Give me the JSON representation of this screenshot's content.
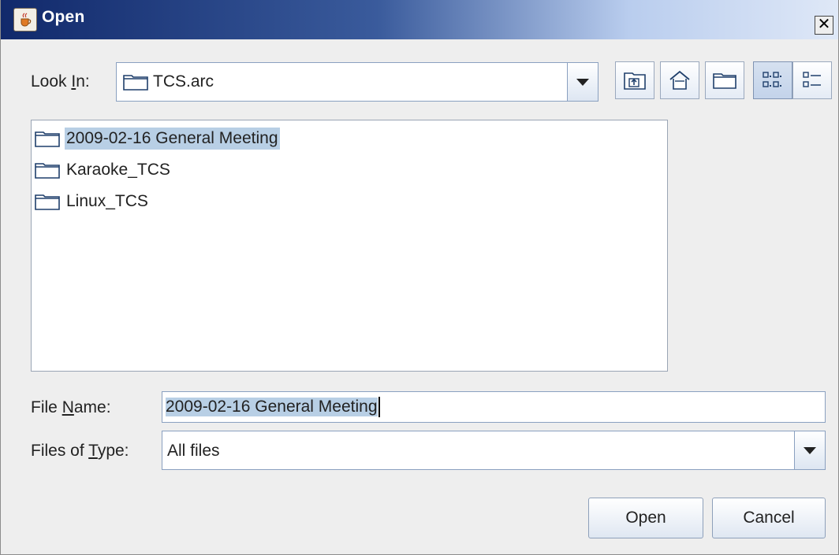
{
  "window": {
    "title": "Open"
  },
  "lookin": {
    "label_pre": "Look ",
    "label_mn": "I",
    "label_post": "n:",
    "value": "TCS.arc"
  },
  "toolbar": {
    "up_folder": "up-one-level-icon",
    "home": "home-icon",
    "new_folder": "new-folder-icon",
    "list_view": "list-view-icon",
    "details_view": "details-view-icon"
  },
  "files": [
    {
      "name": "2009-02-16 General Meeting",
      "selected": true
    },
    {
      "name": "Karaoke_TCS",
      "selected": false
    },
    {
      "name": "Linux_TCS",
      "selected": false
    }
  ],
  "filename": {
    "label_pre": "File ",
    "label_mn": "N",
    "label_post": "ame:",
    "value": "2009-02-16 General Meeting"
  },
  "filetype": {
    "label_pre": "Files of ",
    "label_mn": "T",
    "label_post": "ype:",
    "value": "All files"
  },
  "buttons": {
    "open": "Open",
    "cancel": "Cancel"
  },
  "colors": {
    "selection": "#b8cfe5",
    "title_dark": "#11296b"
  }
}
